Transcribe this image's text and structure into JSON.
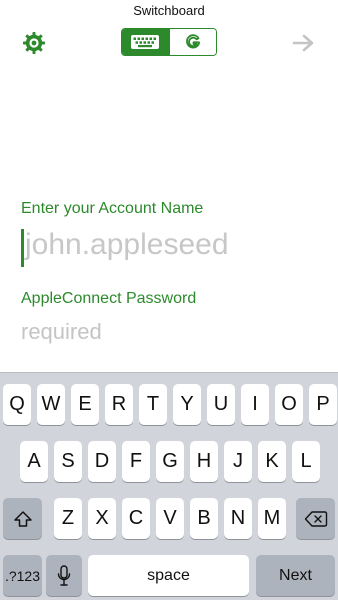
{
  "app": {
    "title": "Switchboard"
  },
  "icons": {
    "settings": "gear-icon",
    "keyboard": "keyboard-icon",
    "g_logo": "g-logo-icon",
    "next_arrow": "arrow-right-icon",
    "shift": "shift-icon",
    "backspace": "backspace-icon",
    "mic": "microphone-icon"
  },
  "colors": {
    "accent": "#2c8a2c",
    "placeholder": "#c7c7c7"
  },
  "form": {
    "account_label": "Enter your Account Name",
    "account_placeholder": "john.appleseed",
    "password_label": "AppleConnect Password",
    "password_placeholder": "required"
  },
  "keyboard": {
    "row1": [
      "Q",
      "W",
      "E",
      "R",
      "T",
      "Y",
      "U",
      "I",
      "O",
      "P"
    ],
    "row2": [
      "A",
      "S",
      "D",
      "F",
      "G",
      "H",
      "J",
      "K",
      "L"
    ],
    "row3": [
      "Z",
      "X",
      "C",
      "V",
      "B",
      "N",
      "M"
    ],
    "numbers_label": ".?123",
    "space_label": "space",
    "next_label": "Next"
  }
}
